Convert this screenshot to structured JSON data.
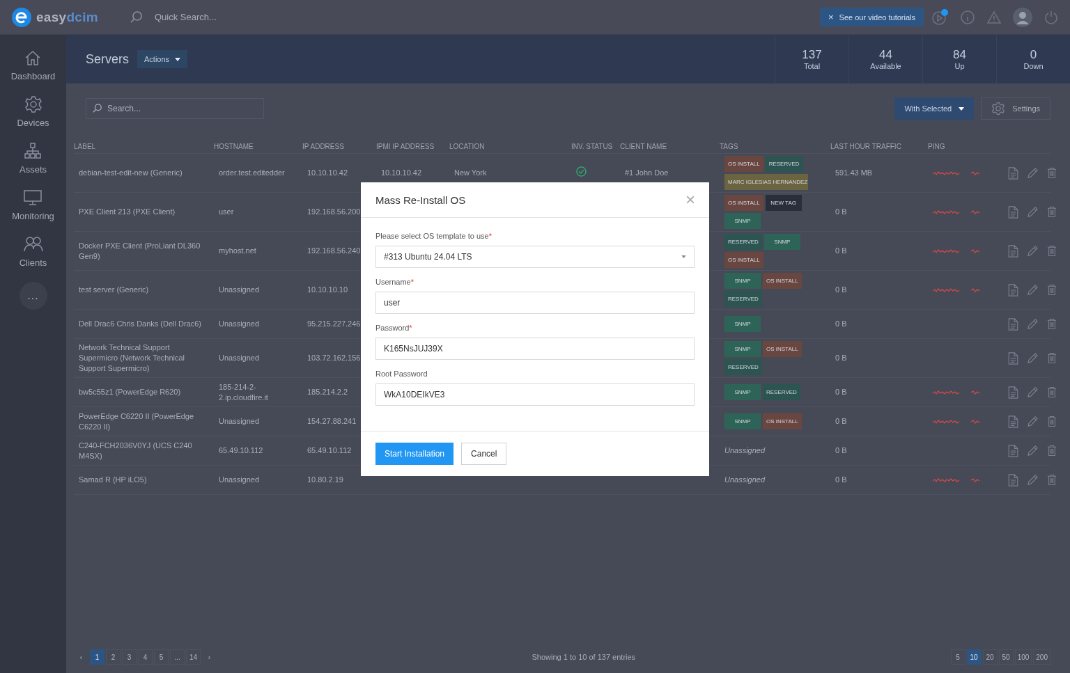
{
  "topbar": {
    "logo": {
      "first": "easy",
      "second": "dcim"
    },
    "search": {
      "placeholder": "Quick Search..."
    },
    "tooltip": {
      "close": "×",
      "text": "See our video tutorials"
    }
  },
  "sidebar": {
    "items": [
      {
        "label": "Dashboard"
      },
      {
        "label": "Devices"
      },
      {
        "label": "Assets"
      },
      {
        "label": "Monitoring"
      },
      {
        "label": "Clients"
      }
    ],
    "more": "..."
  },
  "header": {
    "title": "Servers",
    "actions": "Actions",
    "stats": [
      {
        "value": "137",
        "label": "Total"
      },
      {
        "value": "44",
        "label": "Available"
      },
      {
        "value": "84",
        "label": "Up"
      },
      {
        "value": "0",
        "label": "Down"
      }
    ]
  },
  "toolbar": {
    "search": {
      "placeholder": "Search..."
    },
    "with_selected": "With Selected",
    "settings": "Settings"
  },
  "table": {
    "columns": [
      "LABEL",
      "HOSTNAME",
      "IP ADDRESS",
      "IPMI IP ADDRESS",
      "LOCATION",
      "INV. STATUS",
      "CLIENT NAME",
      "TAGS",
      "LAST HOUR TRAFFIC",
      "PING"
    ],
    "rows": [
      {
        "label": "debian-test-edit-new (Generic)",
        "hostname": "order.test.editedder",
        "ip": "10.10.10.42",
        "ipmi": "10.10.10.42",
        "location": "New York",
        "inv_checked": true,
        "client": "#1 John Doe",
        "tags": [
          {
            "label": "OS INSTALL",
            "color": "#6a4640"
          },
          {
            "label": "RESERVED",
            "color": "#2c5450"
          },
          {
            "label": "MARC IGLESIAS HERNANDEZ",
            "color": "#6a6440"
          }
        ],
        "traffic": "591.43 MB",
        "ping_graph": true
      },
      {
        "label": "PXE Client 213 (PXE Client)",
        "hostname": "user",
        "ip": "192.168.56.200",
        "tags": [
          {
            "label": "OS INSTALL",
            "color": "#6a4640"
          },
          {
            "label": "NEW TAG",
            "color": "#2a2e3a"
          },
          {
            "label": "SNMP",
            "color": "#2e6458"
          }
        ],
        "traffic": "0 B",
        "ping_graph": true
      },
      {
        "label": "Docker PXE Client (ProLiant DL360 Gen9)",
        "hostname": "myhost.net",
        "ip": "192.168.56.240",
        "tags": [
          {
            "label": "RESERVED",
            "color": "#2c5450"
          },
          {
            "label": "SNMP",
            "color": "#2e6458"
          },
          {
            "label": "OS INSTALL",
            "color": "#6a4640"
          }
        ],
        "traffic": "0 B",
        "ping_graph": true
      },
      {
        "label": "test server (Generic)",
        "hostname": "Unassigned",
        "ip": "10.10.10.10",
        "tags": [
          {
            "label": "SNMP",
            "color": "#2e6458"
          },
          {
            "label": "OS INSTALL",
            "color": "#6a4640"
          },
          {
            "label": "RESERVED",
            "color": "#2c5450"
          }
        ],
        "traffic": "0 B",
        "ping_graph": true
      },
      {
        "label": "Dell Drac6 Chris Danks (Dell Drac6)",
        "hostname": "Unassigned",
        "ip": "95.215.227.246",
        "tags": [
          {
            "label": "SNMP",
            "color": "#2e6458"
          }
        ],
        "traffic": "0 B",
        "ping_graph": false
      },
      {
        "label": "Network Technical Support Supermicro (Network Technical Support Supermicro)",
        "hostname": "Unassigned",
        "ip": "103.72.162.156",
        "tags": [
          {
            "label": "SNMP",
            "color": "#2e6458"
          },
          {
            "label": "OS INSTALL",
            "color": "#6a4640"
          },
          {
            "label": "RESERVED",
            "color": "#2c5450"
          }
        ],
        "traffic": "0 B",
        "ping_graph": false
      },
      {
        "label": "bw5c55z1 (PowerEdge R620)",
        "hostname": "185-214-2-2.ip.cloudfire.it",
        "ip": "185.214.2.2",
        "tags": [
          {
            "label": "SNMP",
            "color": "#2e6458"
          },
          {
            "label": "RESERVED",
            "color": "#2c5450"
          }
        ],
        "traffic": "0 B",
        "ping_graph": true
      },
      {
        "label": "PowerEdge C6220 II (PowerEdge C6220 II)",
        "hostname": "Unassigned",
        "ip": "154.27.88.241",
        "tags": [
          {
            "label": "SNMP",
            "color": "#2e6458"
          },
          {
            "label": "OS INSTALL",
            "color": "#6a4640"
          }
        ],
        "traffic": "0 B",
        "ping_graph": true
      },
      {
        "label": "C240-FCH2036V0YJ (UCS C240 M4SX)",
        "hostname": "65.49.10.112",
        "ip": "65.49.10.112",
        "tags_text": "Unassigned",
        "traffic": "0 B",
        "ping_graph": false
      },
      {
        "label": "Samad R (HP iLO5)",
        "hostname": "Unassigned",
        "ip": "10.80.2.19",
        "tags_text": "Unassigned",
        "traffic": "0 B",
        "ping_graph": true
      }
    ]
  },
  "pagination": {
    "prev": "‹",
    "pages": [
      {
        "label": "1",
        "selected": true
      },
      {
        "label": "2",
        "selected": false
      },
      {
        "label": "3",
        "selected": false
      },
      {
        "label": "4",
        "selected": false
      },
      {
        "label": "5",
        "selected": false
      },
      {
        "label": "...",
        "selected": false
      },
      {
        "label": "14",
        "selected": false
      }
    ],
    "next": "›",
    "info": "Showing 1 to 10 of 137 entries",
    "page_sizes": [
      {
        "label": "5",
        "selected": false
      },
      {
        "label": "10",
        "selected": true
      },
      {
        "label": "20",
        "selected": false
      },
      {
        "label": "50",
        "selected": false
      },
      {
        "label": "100",
        "selected": false
      },
      {
        "label": "200",
        "selected": false
      }
    ]
  },
  "modal": {
    "title": "Mass Re-Install OS",
    "close": "×",
    "fields": [
      {
        "kind": "select",
        "label": "Please select OS template to use",
        "required_mark": "*",
        "value": "#313 Ubuntu 24.04 LTS"
      },
      {
        "kind": "text",
        "label": "Username",
        "required_mark": "*",
        "value": "user"
      },
      {
        "kind": "text",
        "label": "Password",
        "required_mark": "*",
        "value": "K165NsJUJ39X"
      },
      {
        "kind": "text",
        "label": "Root Password",
        "value": "WkA10DEIkVE3"
      }
    ],
    "primary": "Start Installation",
    "secondary": "Cancel"
  }
}
